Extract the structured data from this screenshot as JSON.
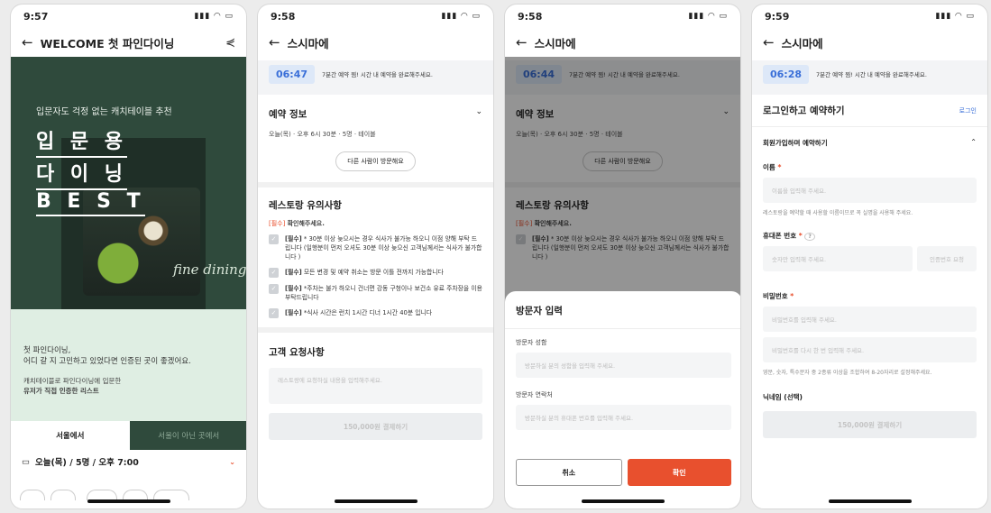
{
  "phone1": {
    "time": "9:57",
    "title": "WELCOME 첫 파인다이닝",
    "hero_subtitle": "입문자도 걱정 없는 캐치테이블 추천",
    "hero_big1": "입 문 용",
    "hero_big2": "다 이 닝",
    "hero_big3": "B E S T",
    "hero_script": "fine dining",
    "line1": "첫 파인다이닝,",
    "line2": "어디 갈 지 고민하고 있었다면 인증된 곳이 좋겠어요.",
    "line3": "캐치테이블로 파인다이닝에 입문한",
    "line4": "유저가 직접 인증한 리스트",
    "tab_seoul": "서울에서",
    "tab_other": "서울이 아닌 곳에서",
    "date_row": "오늘(목) / 5명 / 오후 7:00"
  },
  "phone2": {
    "time": "9:58",
    "title": "스시마에",
    "timer": "06:47",
    "timer_msg": "7분간 예약 찜! 시간 내 예약을 완료해주세요.",
    "reservation_title": "예약 정보",
    "reservation_detail": "오늘(목) · 오후 6시 30분 · 5명 · 테이블",
    "other_visitor_btn": "다른 사람이 방문해요",
    "notice_title": "레스토랑 유의사항",
    "notice_req": "[필수]",
    "notice_sub": "확인해주세요.",
    "notices": [
      {
        "tag": "[필수]",
        "text": "* 30분 이상 늦으시는 경우 식사가 불가능 하오니 이점 양해 부탁 드립니다 (일행분이 먼저 오셔도 30분 이상 늦으신 고객님께서는 식사가 불가합니다 )"
      },
      {
        "tag": "[필수]",
        "text": "모든 변경 및 예약 취소는 방문 이틀 전까지 가능합니다"
      },
      {
        "tag": "[필수]",
        "text": "*주차는 불가 하오니 건너편 강동 구청이나 보건소 유료 주차장을 이용 부탁드립니다"
      },
      {
        "tag": "[필수]",
        "text": "*식사 시간은 런치 1시간 디너 1시간 40분 입니다"
      }
    ],
    "request_title": "고객 요청사항",
    "request_placeholder": "레스토랑에 요청하실 내용을 입력해주세요.",
    "pay_btn": "150,000원 결제하기"
  },
  "phone3": {
    "time": "9:58",
    "title": "스시마에",
    "timer": "06:44",
    "timer_msg": "7분간 예약 찜! 시간 내 예약을 완료해주세요.",
    "reservation_title": "예약 정보",
    "reservation_detail": "오늘(목) · 오후 6시 30분 · 5명 · 테이블",
    "other_visitor_btn": "다른 사람이 방문해요",
    "notice_title": "레스토랑 유의사항",
    "notice_req": "[필수]",
    "notice_sub": "확인해주세요.",
    "notice1_tag": "[필수]",
    "notice1": "* 30분 이상 늦으시는 경우 식사가 불가능 하오니 이점 양해 부탁 드립니다 (일행분이 먼저 오셔도 30분 이상 늦으신 고객님께서는 식사가 불가합니다 )",
    "sheet_title": "방문자 입력",
    "name_label": "방문자 성함",
    "name_placeholder": "방문하실 분의 성함을 입력해 주세요.",
    "contact_label": "방문자 연락처",
    "contact_placeholder": "방문하실 분의 휴대폰 번호를 입력해 주세요.",
    "cancel": "취소",
    "confirm": "확인"
  },
  "phone4": {
    "time": "9:59",
    "title": "스시마에",
    "timer": "06:28",
    "timer_msg": "7분간 예약 찜! 시간 내 예약을 완료해주세요.",
    "login_title": "로그인하고 예약하기",
    "login_link": "로그인",
    "signup_title": "회원가입하며 예약하기",
    "name_label": "이름",
    "name_placeholder": "이름을 입력해 주세요.",
    "name_help": "레스토랑을 예약할 때 사용할 이름이므로 꼭 실명을 사용해 주세요.",
    "phone_label": "휴대폰 번호",
    "phone_placeholder": "숫자만 입력해 주세요.",
    "verify_btn": "인증번호 요청",
    "pw_label": "비밀번호",
    "pw_placeholder": "비밀번호를 입력해 주세요.",
    "pw2_placeholder": "비밀번호를 다시 한 번 입력해 주세요.",
    "pw_help": "영문, 숫자, 특수문자 중 2종류 이상을 조합하여 8-20자리로 설정해주세요.",
    "nickname_label": "닉네임 (선택)",
    "pay_btn": "150,000원 결제하기"
  },
  "colors": {
    "accent": "#e8502e",
    "timer": "#3a6fd8",
    "hero_green": "#2f4a3c",
    "mint": "#dfeee3"
  }
}
